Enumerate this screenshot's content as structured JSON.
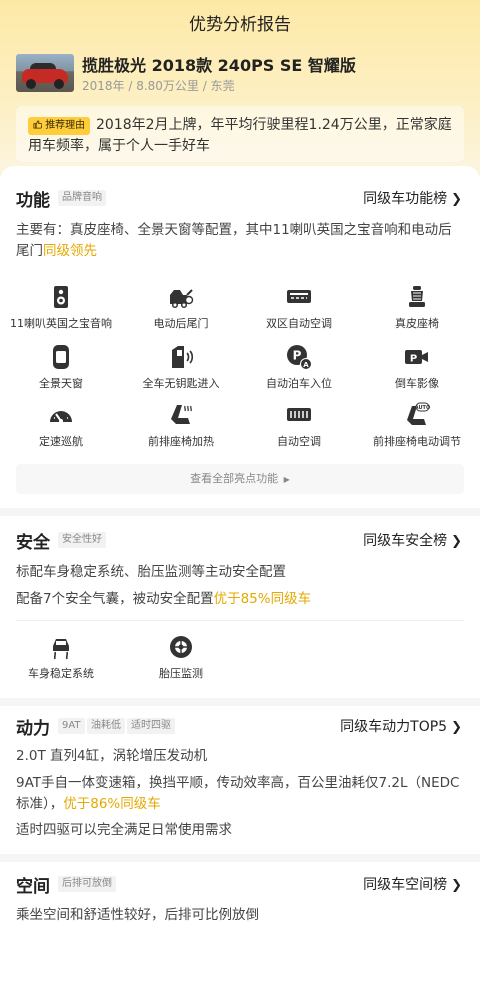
{
  "header": {
    "title": "优势分析报告"
  },
  "car": {
    "name": "揽胜极光 2018款 240PS SE 智耀版",
    "meta": "2018年 / 8.80万公里 / 东莞"
  },
  "reason": {
    "badge": "推荐理由",
    "text": "2018年2月上牌，年平均行驶里程1.24万公里，正常家庭用车频率，属于个人一手好车"
  },
  "function_section": {
    "title": "功能",
    "tag": "品牌音响",
    "rank_label": "同级车功能榜",
    "desc_main": "主要有：真皮座椅、全景天窗等配置，其中11喇叭英国之宝音响和电动后尾门",
    "desc_highlight": "同级领先",
    "features": [
      {
        "label": "11喇叭英国之宝音响",
        "icon": "speaker-icon"
      },
      {
        "label": "电动后尾门",
        "icon": "tailgate-icon"
      },
      {
        "label": "双区自动空调",
        "icon": "dual-zone-ac-icon"
      },
      {
        "label": "真皮座椅",
        "icon": "leather-seat-icon"
      },
      {
        "label": "全景天窗",
        "icon": "panoramic-sunroof-icon"
      },
      {
        "label": "全车无钥匙进入",
        "icon": "keyless-entry-icon"
      },
      {
        "label": "自动泊车入位",
        "icon": "auto-parking-icon"
      },
      {
        "label": "倒车影像",
        "icon": "rear-camera-icon"
      },
      {
        "label": "定速巡航",
        "icon": "cruise-control-icon"
      },
      {
        "label": "前排座椅加热",
        "icon": "seat-heating-icon"
      },
      {
        "label": "自动空调",
        "icon": "auto-ac-icon"
      },
      {
        "label": "前排座椅电动调节",
        "icon": "power-seat-icon"
      }
    ],
    "view_all": "查看全部亮点功能"
  },
  "safety_section": {
    "title": "安全",
    "tag": "安全性好",
    "rank_label": "同级车安全榜",
    "line1": "标配车身稳定系统、胎压监测等主动安全配置",
    "line2_main": "配备7个安全气囊，被动安全配置",
    "line2_highlight": "优于85%同级车",
    "features": [
      {
        "label": "车身稳定系统",
        "icon": "stability-control-icon"
      },
      {
        "label": "胎压监测",
        "icon": "tire-pressure-icon"
      }
    ]
  },
  "power_section": {
    "title": "动力",
    "tags": [
      "9AT",
      "油耗低",
      "适时四驱"
    ],
    "rank_label": "同级车动力TOP5",
    "line1": "2.0T 直列4缸，涡轮增压发动机",
    "line2_main": "9AT手自一体变速箱，换挡平顺，传动效率高，百公里油耗仅7.2L（NEDC标准），",
    "line2_highlight": "优于86%同级车",
    "line3": "适时四驱可以完全满足日常使用需求"
  },
  "space_section": {
    "title": "空间",
    "tag": "后排可放倒",
    "rank_label": "同级车空间榜",
    "line1": "乘坐空间和舒适性较好，后排可比例放倒"
  },
  "colors": {
    "accent": "#e6a800",
    "badge": "#ffcd3c",
    "header_bg": "#fde9a6"
  }
}
